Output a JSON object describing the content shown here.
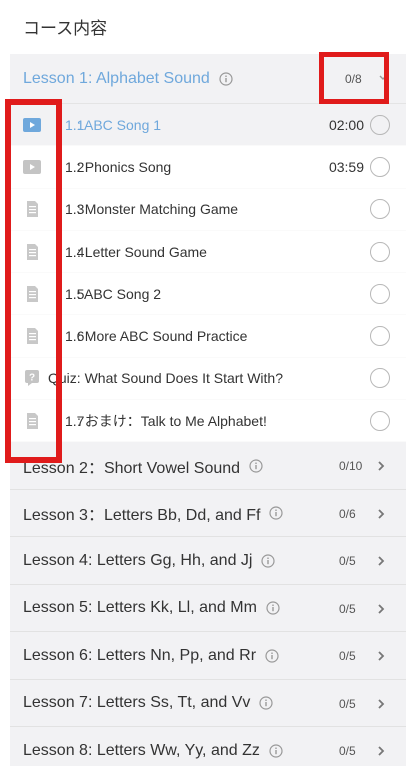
{
  "page": {
    "title": "コース内容"
  },
  "active_lesson": {
    "title": "Lesson 1: Alphabet Sound",
    "count": "0/8",
    "items": [
      {
        "num": "1.1",
        "label": ": ABC Song 1",
        "duration": "02:00",
        "icon": "video-icon",
        "current": true
      },
      {
        "num": "1.2",
        "label": ": Phonics Song",
        "duration": "03:59",
        "icon": "video-icon",
        "current": false
      },
      {
        "num": "1.3",
        "label": ": Monster Matching Game",
        "duration": "",
        "icon": "document-icon",
        "current": false
      },
      {
        "num": "1.4",
        "label": ": Letter Sound Game",
        "duration": "",
        "icon": "document-icon",
        "current": false
      },
      {
        "num": "1.5",
        "label": ": ABC Song 2",
        "duration": "",
        "icon": "document-icon",
        "current": false
      },
      {
        "num": "1.6",
        "label": ": More ABC Sound Practice",
        "duration": "",
        "icon": "document-icon",
        "current": false
      },
      {
        "num": "",
        "label": "Quiz: What Sound Does It Start With?",
        "duration": "",
        "icon": "quiz-icon",
        "current": false
      },
      {
        "num": "1.7",
        "label": ": おまけ：Talk to Me Alphabet!",
        "duration": "",
        "icon": "document-icon",
        "current": false
      }
    ]
  },
  "lessons": [
    {
      "title": "Lesson 2：Short Vowel Sound",
      "count": "0/10"
    },
    {
      "title": "Lesson 3：Letters Bb, Dd, and Ff",
      "count": "0/6"
    },
    {
      "title": "Lesson 4: Letters Gg, Hh, and Jj",
      "count": "0/5"
    },
    {
      "title": "Lesson 5: Letters Kk, Ll, and Mm",
      "count": "0/5"
    },
    {
      "title": "Lesson 6: Letters Nn, Pp, and Rr",
      "count": "0/5"
    },
    {
      "title": "Lesson 7: Letters Ss, Tt, and Vv",
      "count": "0/5"
    },
    {
      "title": "Lesson 8: Letters Ww, Yy, and Zz",
      "count": "0/5"
    }
  ],
  "colors": {
    "accent": "#6fa8dc",
    "highlight": "#e01b1b",
    "row_bg": "#f2f2f4"
  }
}
